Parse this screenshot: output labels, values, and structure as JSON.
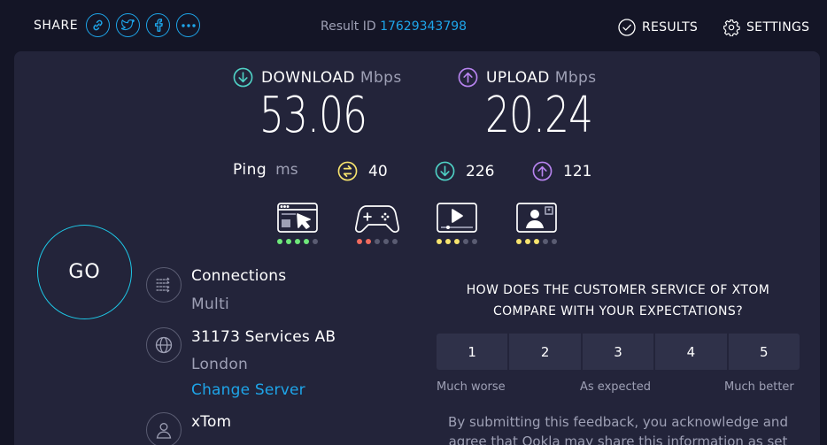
{
  "header": {
    "share_label": "SHARE",
    "share_buttons": [
      {
        "icon": "link-icon"
      },
      {
        "icon": "twitter-icon"
      },
      {
        "icon": "facebook-icon"
      },
      {
        "icon": "more-icon"
      }
    ],
    "result_id_label": "Result ID",
    "result_id": "17629343798",
    "results_label": "RESULTS",
    "settings_label": "SETTINGS"
  },
  "download": {
    "label": "DOWNLOAD",
    "unit": "Mbps",
    "value": "53.06"
  },
  "upload": {
    "label": "UPLOAD",
    "unit": "Mbps",
    "value": "20.24"
  },
  "ping": {
    "label": "Ping",
    "unit": "ms",
    "idle": "40",
    "download": "226",
    "upload": "121"
  },
  "quality_ratings": [
    {
      "icon": "web-browsing-icon",
      "rating": 4,
      "color": "#6ee87a"
    },
    {
      "icon": "gaming-icon",
      "rating": 2,
      "color": "#f26b5e"
    },
    {
      "icon": "video-streaming-icon",
      "rating": 3,
      "color": "#f7e46e"
    },
    {
      "icon": "video-chat-icon",
      "rating": 3,
      "color": "#f7e46e"
    }
  ],
  "go_label": "GO",
  "connections": {
    "title": "Connections",
    "value": "Multi"
  },
  "server": {
    "name": "31173 Services AB",
    "location": "London",
    "change_label": "Change Server"
  },
  "isp": {
    "name": "xTom"
  },
  "survey": {
    "question": "HOW DOES THE CUSTOMER SERVICE OF XTOM COMPARE WITH YOUR EXPECTATIONS?",
    "options": [
      "1",
      "2",
      "3",
      "4",
      "5"
    ],
    "low_label": "Much worse",
    "mid_label": "As expected",
    "high_label": "Much better",
    "disclaimer": "By submitting this feedback, you acknowledge and agree that Ookla may share this information as set"
  },
  "colors": {
    "accent": "#1ea5e9",
    "download": "#4fd1c5",
    "upload": "#b884f0",
    "ping": "#f7e46e",
    "go_ring": "#1ec7e6"
  }
}
